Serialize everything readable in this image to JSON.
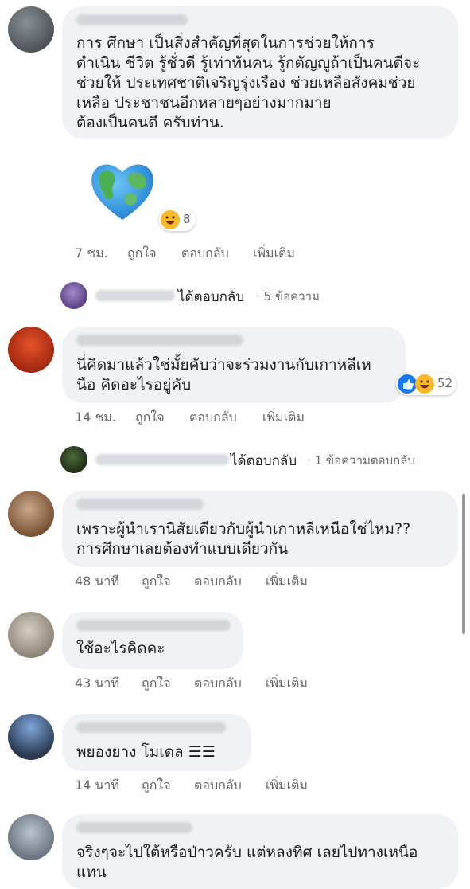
{
  "comments": [
    {
      "lines": [
        "การ ศึกษา เป็นสิ่งสำคัญที่สุดในการช่วยให้การ",
        "ดำเนิน ชีวิต รู้ชั่วดี รู้เท่าทันคน รู้กตัญญูถ้าเป็นคนดีจะ",
        "ช่วยให้ ประเทศชาติเจริญรุ่งเรือง ช่วยเหลือสังคมช่วย",
        "เหลือ ประชาชนอีกหลายๆอย่างมากมาย",
        "ต้องเป็นคนดี ครับท่าน."
      ],
      "reaction_count": "8",
      "time": "7 ชม.",
      "like": "ถูกใจ",
      "reply": "ตอบกลับ",
      "more": "เพิ่มเติม"
    },
    {
      "lines": [
        "นี่คิดมาแล้วใช่มั้ยคับว่าจะร่วมงานกับเกาหลีเห",
        "นือ คิดอะไรอยู่คับ"
      ],
      "reaction_count": "52",
      "time": "14 ชม.",
      "like": "ถูกใจ",
      "reply": "ตอบกลับ",
      "more": "เพิ่มเติม"
    },
    {
      "lines": [
        "เพราะผู้นำเรานิสัยเดียวกับผู้นำเกาหลีเหนือใช่ไหม??",
        "การศึกษาเลยต้องทำแบบเดียวกัน"
      ],
      "time": "48 นาที",
      "like": "ถูกใจ",
      "reply": "ตอบกลับ",
      "more": "เพิ่มเติม"
    },
    {
      "lines": [
        "ใช้อะไรคิดคะ"
      ],
      "time": "43 นาที",
      "like": "ถูกใจ",
      "reply": "ตอบกลับ",
      "more": "เพิ่มเติม"
    },
    {
      "lines": [
        "พยองยาง โมเดล ☰☰"
      ],
      "time": "14 นาที",
      "like": "ถูกใจ",
      "reply": "ตอบกลับ",
      "more": "เพิ่มเติม"
    },
    {
      "lines": [
        "จริงๆจะไปใต้หรือป่าวครับ แต่หลงทิศ เลยไปทางเหนือ",
        "แทน"
      ]
    }
  ],
  "replies": [
    {
      "text": "ได้ตอบกลับ",
      "count": "· 5 ข้อความ"
    },
    {
      "text": "ได้ตอบกลับ",
      "count": "· 1 ข้อความตอบกลับ"
    }
  ],
  "colors": {
    "bubble": "#f0f2f5",
    "meta": "#65676b",
    "text": "#1c1e21",
    "like_blue": "#1877f2",
    "haha_yellow": "#f7b928"
  }
}
